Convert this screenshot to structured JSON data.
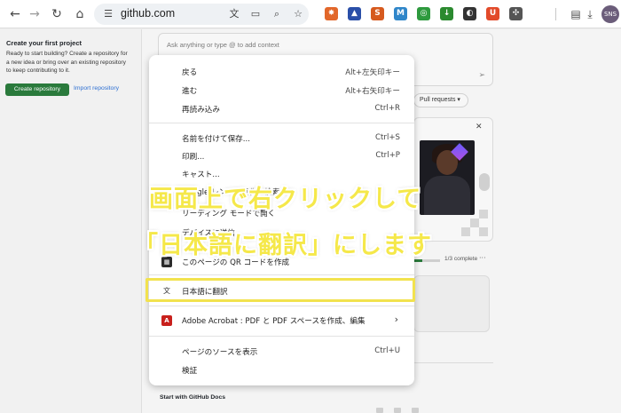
{
  "browser": {
    "url": "github.com",
    "nav": {
      "back_icon": "back-arrow-icon",
      "forward_icon": "forward-arrow-icon",
      "reload_icon": "reload-icon",
      "home_icon": "home-icon"
    },
    "extensions": [
      {
        "name": "ext-orange-icon",
        "glyph": "✸",
        "color": "#e2672a"
      },
      {
        "name": "ext-triangle-icon",
        "glyph": "▲",
        "color": "#2a4fa8"
      },
      {
        "name": "ext-swirl-icon",
        "glyph": "S",
        "color": "#d65a1e"
      },
      {
        "name": "ext-m-icon",
        "glyph": "M",
        "color": "#2f86c9"
      },
      {
        "name": "ext-target-icon",
        "glyph": "◎",
        "color": "#2e9a3e"
      },
      {
        "name": "ext-download-icon",
        "glyph": "↓",
        "color": "#2b8a2f"
      },
      {
        "name": "ext-circle-icon",
        "glyph": "◐",
        "color": "#333333"
      },
      {
        "name": "ext-u-icon",
        "glyph": "U",
        "color": "#e24a2a"
      },
      {
        "name": "ext-puzzle-icon",
        "glyph": "✣",
        "color": "#555555"
      }
    ],
    "avatar_text": "SNS"
  },
  "left_panel": {
    "title": "Create your first project",
    "description": "Ready to start building? Create a repository for a new idea or bring over an existing repository to keep contributing to it.",
    "create_button": "Create repository",
    "import_link": "Import repository"
  },
  "main": {
    "ask_placeholder": "Ask anything or type @ to add context",
    "pull_requests_label": "Pull requests ▾",
    "progress": {
      "value": 0.33,
      "text": "1/3 complete"
    },
    "docs_title": "Start with GitHub Docs"
  },
  "context_menu": {
    "groups": [
      [
        {
          "label": "戻る",
          "shortcut": "Alt+左矢印キー"
        },
        {
          "label": "進む",
          "shortcut": "Alt+右矢印キー"
        },
        {
          "label": "再読み込み",
          "shortcut": "Ctrl+R"
        }
      ],
      [
        {
          "label": "名前を付けて保存...",
          "shortcut": "Ctrl+S"
        },
        {
          "label": "印刷...",
          "shortcut": "Ctrl+P"
        },
        {
          "label": "キャスト...",
          "shortcut": ""
        },
        {
          "label": "Google レンズで画像を検索",
          "shortcut": ""
        },
        {
          "label": "リーディング モードで開く",
          "shortcut": ""
        },
        {
          "label": "デバイスに送信",
          "shortcut": ""
        },
        {
          "label": "このページの QR コードを作成",
          "shortcut": ""
        }
      ],
      [
        {
          "label": "日本語に翻訳",
          "shortcut": ""
        }
      ],
      [
        {
          "label": "Adobe Acrobat : PDF と PDF スペースを作成、編集",
          "shortcut": "›"
        }
      ],
      [
        {
          "label": "ページのソースを表示",
          "shortcut": "Ctrl+U"
        },
        {
          "label": "検証",
          "shortcut": ""
        }
      ]
    ],
    "icons": {
      "qr": "qr-code-icon",
      "translate": "translate-icon",
      "adobe": "adobe-acrobat-icon"
    }
  },
  "caption": {
    "line1": "画面上で右クリックして",
    "line2": "「日本語に翻訳」にします",
    "color": "#f5e84a"
  }
}
